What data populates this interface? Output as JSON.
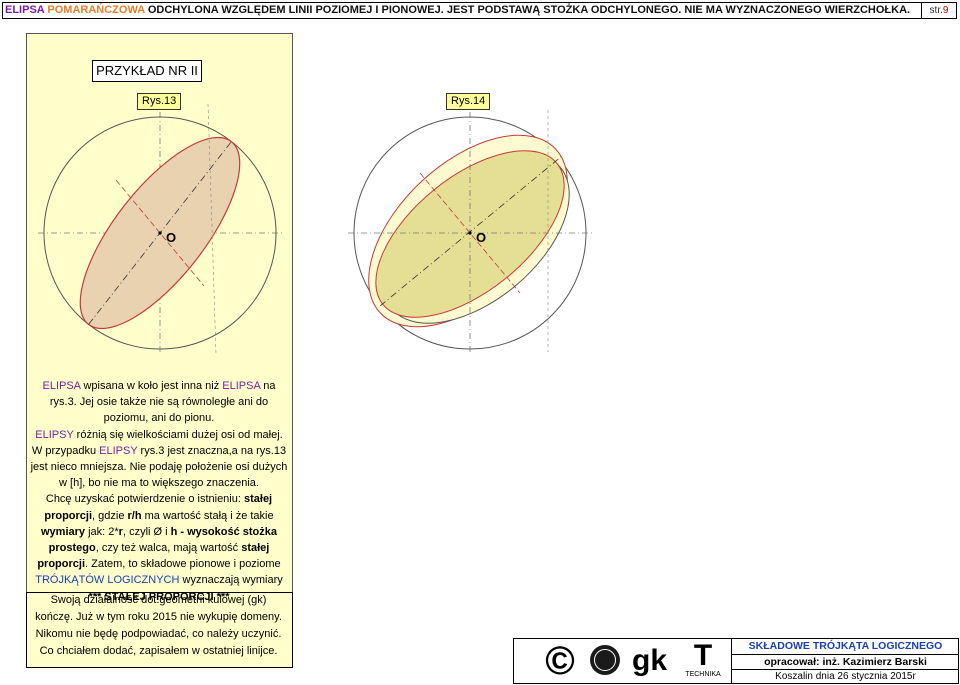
{
  "header": {
    "part1": "ELIPSA",
    "part2": "POMARAŃCZOWA",
    "part3": "ODCHYLONA WZGLĘDEM LINII POZIOMEJ I PIONOWEJ. JEST PODSTAWĄ STOŻKA ODCHYLONEGO. NIE MA WYZNACZONEGO WIERZCHOŁKA.",
    "page_label": "str.",
    "page_number": "9"
  },
  "example": {
    "title": "PRZYKŁAD NR II"
  },
  "figures": {
    "left": {
      "label": "Rys.13",
      "center_label": "O"
    },
    "right": {
      "label": "Rys.14",
      "center_label": "O"
    }
  },
  "text": {
    "s1": "ELIPSA",
    "s2": " wpisana w koło jest inna niż ",
    "s3": "ELIPSA",
    "s4": " na rys.3. Jej osie także nie są równoległe ani do poziomu, ani do pionu.",
    "s5": "ELIPSY",
    "s6": " różnią się wielkościami dużej osi od małej.",
    "s7": "W przypadku ",
    "s8": "ELIPSY",
    "s9": " rys.3 jest znaczna,a na rys.13 jest nieco mniejsza. Nie podaję położenie osi dużych w [h], bo nie ma to większego znaczenia.",
    "s10": "Chcę uzyskać potwierdzenie o istnieniu: ",
    "s11": "stałej proporcji",
    "s12": ", gdzie ",
    "s13": "r/h",
    "s14": " ma wartość stałą i że takie ",
    "s15": "wymiary",
    "s16": " jak: 2*",
    "s17": "r",
    "s18": ", czyli Ø i ",
    "s19": "h - wysokość stożka prostego",
    "s20": ", czy też walca, mają wartość ",
    "s21": "stałej proporcji",
    "s22": ". Zatem, to składowe pionowe i poziome ",
    "s23": "TRÓJKĄTÓW LOGICZNYCH",
    "s24": " wyznaczają wymiary",
    "s25": "*** STAŁEJ PROPORCJI ***"
  },
  "final_note": {
    "line1": "Swoją działalność dot.geometrii kulowej (gk)",
    "line2": "kończę. Już w tym roku 2015 nie wykupię domeny.",
    "line3": "Nikomu nie będę podpowiadać, co należy uczynić.",
    "line4": "Co chciałem dodać, zapisałem w ostatniej linijce."
  },
  "footer": {
    "copyright_symbol": "©",
    "logo_gk": "gk",
    "logo_t": "T",
    "technika": "TECHNIKA",
    "title": "SKŁADOWE TRÓJKĄTA LOGICZNEGO",
    "author": "opracował:   inż. Kazimierz Barski",
    "date": "Koszalin dnia 26 stycznia 2015r"
  },
  "colors": {
    "ellipse_fill": "#e8d2b0",
    "ellipse_stroke": "#c43a3a",
    "pale_fill": "#fffad0",
    "olive_fill": "#e5df96",
    "accent_purple": "#7a1fa2",
    "accent_blue": "#1a3fb5",
    "accent_orange": "#e87d2a"
  }
}
